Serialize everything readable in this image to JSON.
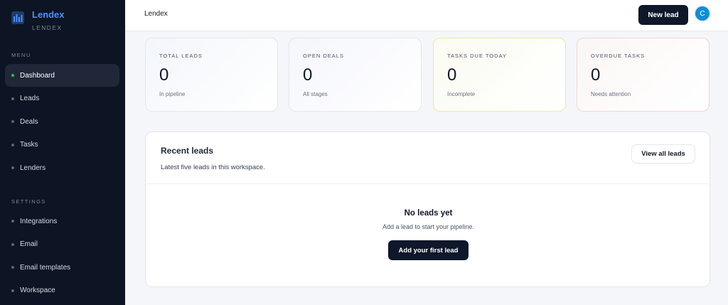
{
  "brand": {
    "name": "Lendex",
    "subtitle": "LENDEX",
    "logo_icon": "bar-chart-icon"
  },
  "sidebar": {
    "menu_label": "MENU",
    "menu_items": [
      {
        "label": "Dashboard",
        "active": true
      },
      {
        "label": "Leads"
      },
      {
        "label": "Deals"
      },
      {
        "label": "Tasks"
      },
      {
        "label": "Lenders"
      }
    ],
    "settings_label": "SETTINGS",
    "settings_items": [
      {
        "label": "Integrations"
      },
      {
        "label": "Email"
      },
      {
        "label": "Email templates"
      },
      {
        "label": "Workspace"
      }
    ]
  },
  "topbar": {
    "title": "Lendex",
    "new_lead_label": "New lead",
    "avatar_initial": "C"
  },
  "stats": [
    {
      "label": "TOTAL LEADS",
      "value": "0",
      "hint": "In pipeline"
    },
    {
      "label": "OPEN DEALS",
      "value": "0",
      "hint": "All stages"
    },
    {
      "label": "TASKS DUE TODAY",
      "value": "0",
      "hint": "Incomplete"
    },
    {
      "label": "OVERDUE TASKS",
      "value": "0",
      "hint": "Needs attention"
    }
  ],
  "recent_leads": {
    "title": "Recent leads",
    "subtitle": "Latest five leads in this workspace.",
    "view_all_label": "View all leads",
    "empty_title": "No leads yet",
    "empty_subtitle": "Add a lead to start your pipeline.",
    "add_first_label": "Add your first lead"
  },
  "colors": {
    "sidebar_bg": "#0d1424",
    "brand": "#4a90ff",
    "active_dot": "#22c55e",
    "primary_button": "#0f172a",
    "avatar": "#0e8fd4"
  }
}
